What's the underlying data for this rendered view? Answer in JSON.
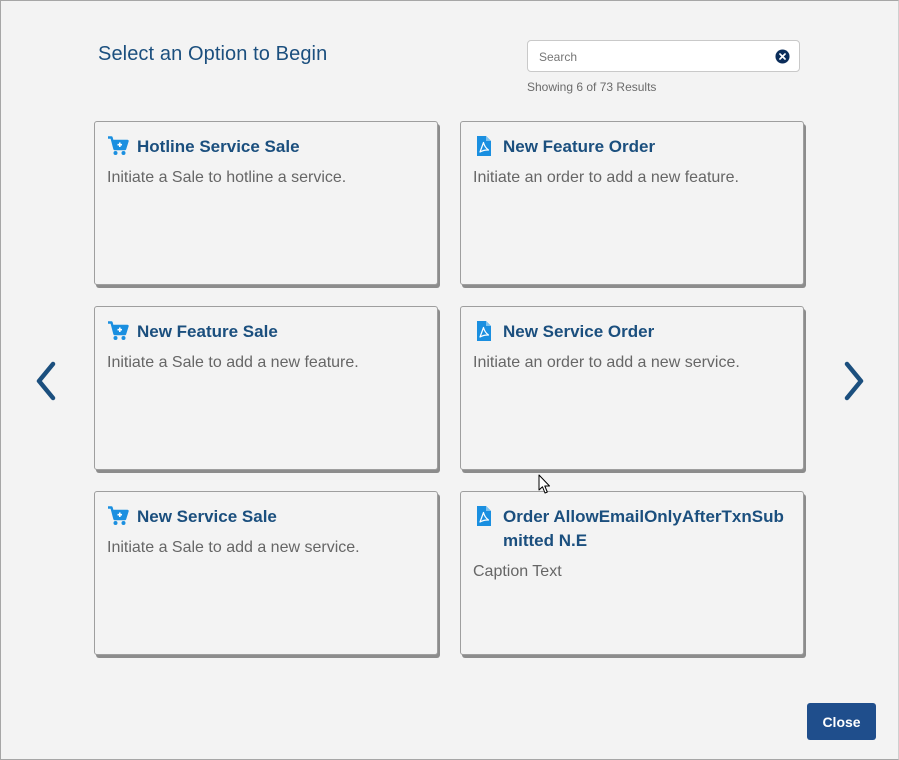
{
  "header": {
    "title": "Select an Option to Begin"
  },
  "search": {
    "placeholder": "Search",
    "value": "",
    "results_text": "Showing 6 of 73 Results"
  },
  "cards": [
    {
      "title": "Hotline Service Sale",
      "description": "Initiate a Sale to hotline a service.",
      "icon": "cart-icon"
    },
    {
      "title": "New Feature Order",
      "description": "Initiate an order to add a new feature.",
      "icon": "pdf-document-icon"
    },
    {
      "title": "New Feature Sale",
      "description": "Initiate a Sale to add a new feature.",
      "icon": "cart-icon"
    },
    {
      "title": "New Service Order",
      "description": "Initiate an order to add a new service.",
      "icon": "pdf-document-icon"
    },
    {
      "title": "New Service Sale",
      "description": "Initiate a Sale to add a new service.",
      "icon": "cart-icon"
    },
    {
      "title": "Order AllowEmailOnlyAfterTxnSubmitted N.E",
      "description": "Caption Text",
      "icon": "pdf-document-icon"
    }
  ],
  "navigation": {
    "prev_icon": "chevron-left-icon",
    "next_icon": "chevron-right-icon"
  },
  "footer": {
    "close_label": "Close"
  },
  "colors": {
    "title_blue": "#1b4f7e",
    "icon_blue": "#1a8fe0",
    "button_blue": "#1f4e8c",
    "background": "#f3f3f3"
  }
}
